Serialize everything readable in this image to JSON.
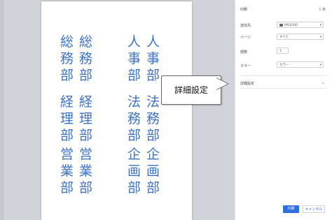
{
  "preview": {
    "columns": [
      {
        "chars": [
          "総",
          "務",
          "部"
        ]
      },
      {
        "chars": [
          "総",
          "務",
          "部"
        ]
      },
      {
        "chars": [
          "人",
          "事",
          "部"
        ]
      },
      {
        "chars": [
          "人",
          "事",
          "部"
        ]
      },
      {
        "chars": [
          "経",
          "理",
          "部"
        ]
      },
      {
        "chars": [
          "経",
          "理",
          "部"
        ]
      },
      {
        "chars": [
          "法",
          "務",
          "部"
        ]
      },
      {
        "chars": [
          "法",
          "務",
          "部"
        ]
      },
      {
        "chars": [
          "営",
          "業",
          "部"
        ]
      },
      {
        "chars": [
          "営",
          "業",
          "部"
        ]
      },
      {
        "chars": [
          "企",
          "画",
          "部"
        ]
      },
      {
        "chars": [
          "企",
          "画",
          "部"
        ]
      }
    ],
    "text_color": "#3d73c4"
  },
  "callout": {
    "text": "詳細設定"
  },
  "panel": {
    "title": "印刷",
    "sheet_count": "1 枚",
    "destination": {
      "label": "送信先",
      "value": "MG6200",
      "icon": "printer-icon"
    },
    "pages": {
      "label": "ページ",
      "value": "すべて"
    },
    "copies": {
      "label": "部数",
      "value": "1"
    },
    "color": {
      "label": "カラー",
      "value": "カラー"
    },
    "advanced": {
      "label": "詳細設定"
    },
    "print_button": "印刷",
    "cancel_button": "キャンセル",
    "accent_color": "#2f6fe0"
  }
}
